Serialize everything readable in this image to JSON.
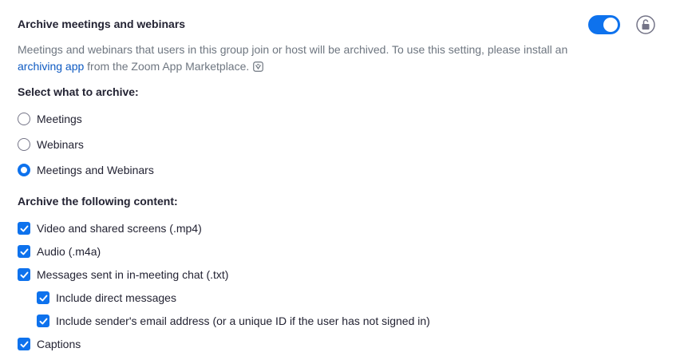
{
  "setting": {
    "title": "Archive meetings and webinars",
    "toggle_on": true,
    "accent_color": "#0e72ed",
    "description_part1": "Meetings and webinars that users in this group join or host will be archived. To use this setting, please install an ",
    "description_link": "archiving app",
    "description_part2": " from the Zoom App Marketplace."
  },
  "archive_select": {
    "label": "Select what to archive:",
    "options": [
      {
        "label": "Meetings",
        "selected": false
      },
      {
        "label": "Webinars",
        "selected": false
      },
      {
        "label": "Meetings and Webinars",
        "selected": true
      }
    ]
  },
  "archive_content": {
    "label": "Archive the following content:",
    "items": [
      {
        "label": "Video and shared screens (.mp4)",
        "checked": true
      },
      {
        "label": "Audio (.m4a)",
        "checked": true
      },
      {
        "label": "Messages sent in in-meeting chat (.txt)",
        "checked": true
      },
      {
        "label": "Include direct messages",
        "checked": true
      },
      {
        "label": "Include sender's email address (or a unique ID if the user has not signed in)",
        "checked": true
      },
      {
        "label": "Captions",
        "checked": true
      }
    ]
  },
  "icons": {
    "toggle": "toggle-switch",
    "lock": "unlock-icon",
    "external": "external-marketplace-icon",
    "check": "checkmark-icon"
  }
}
